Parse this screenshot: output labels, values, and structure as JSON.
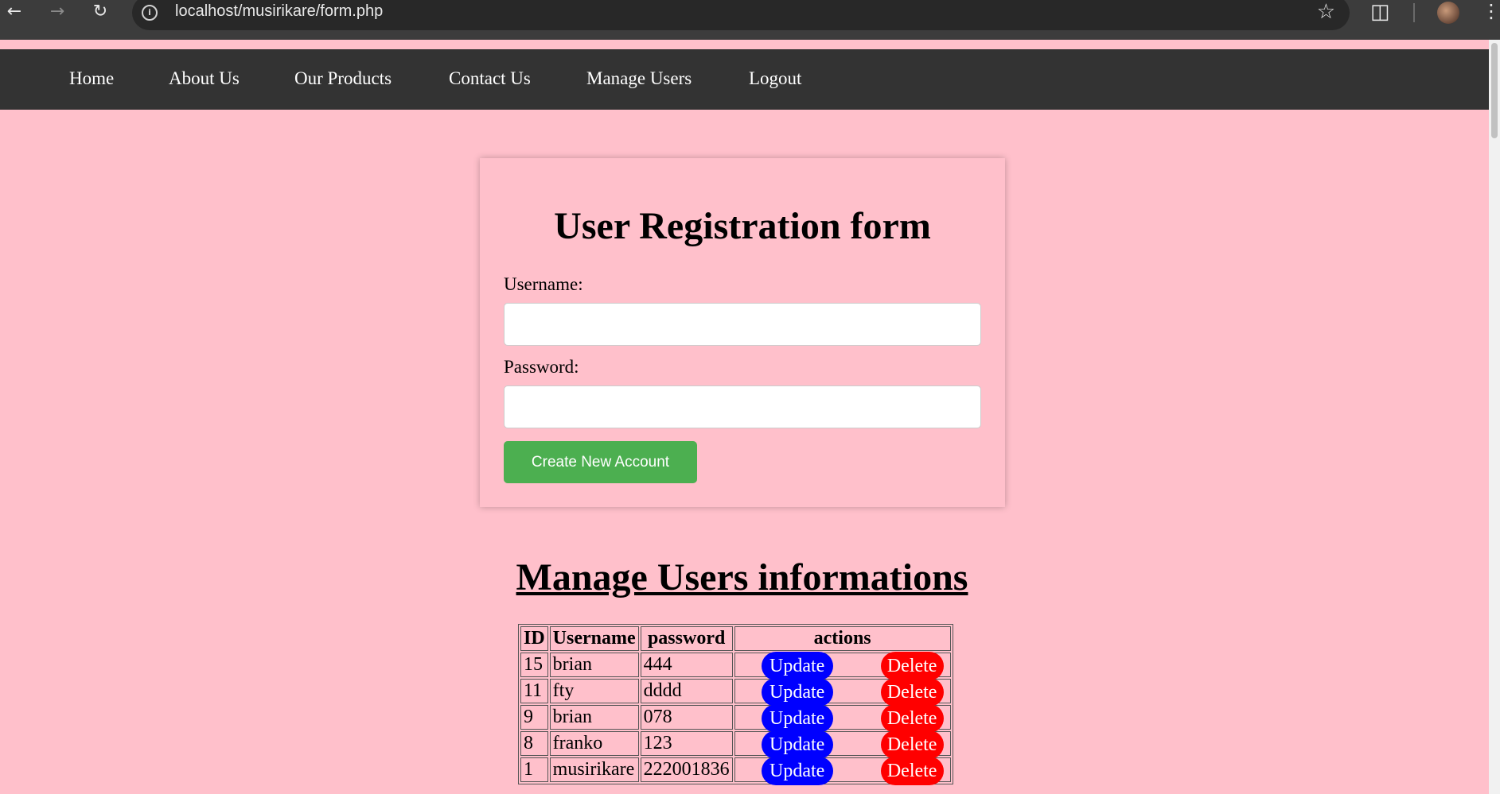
{
  "browser": {
    "url": "localhost/musirikare/form.php"
  },
  "nav": {
    "items": [
      "Home",
      "About Us",
      "Our Products",
      "Contact Us",
      "Manage Users",
      "Logout"
    ]
  },
  "form": {
    "title": "User Registration form",
    "username_label": "Username:",
    "username_value": "",
    "password_label": "Password:",
    "password_value": "",
    "submit_label": "Create New Account"
  },
  "manage": {
    "title": "Manage Users informations",
    "headers": [
      "ID",
      "Username",
      "password",
      "actions"
    ],
    "update_label": "Update",
    "delete_label": "Delete",
    "rows": [
      {
        "id": "15",
        "username": "brian",
        "password": "444"
      },
      {
        "id": "11",
        "username": "fty",
        "password": "dddd"
      },
      {
        "id": "9",
        "username": "brian",
        "password": "078"
      },
      {
        "id": "8",
        "username": "franko",
        "password": "123"
      },
      {
        "id": "1",
        "username": "musirikare",
        "password": "222001836"
      }
    ]
  },
  "colors": {
    "page_bg": "#ffc0cb",
    "nav_bg": "#333333",
    "submit_bg": "#4caf50",
    "update_bg": "#0000ff",
    "delete_bg": "#ff0000"
  }
}
